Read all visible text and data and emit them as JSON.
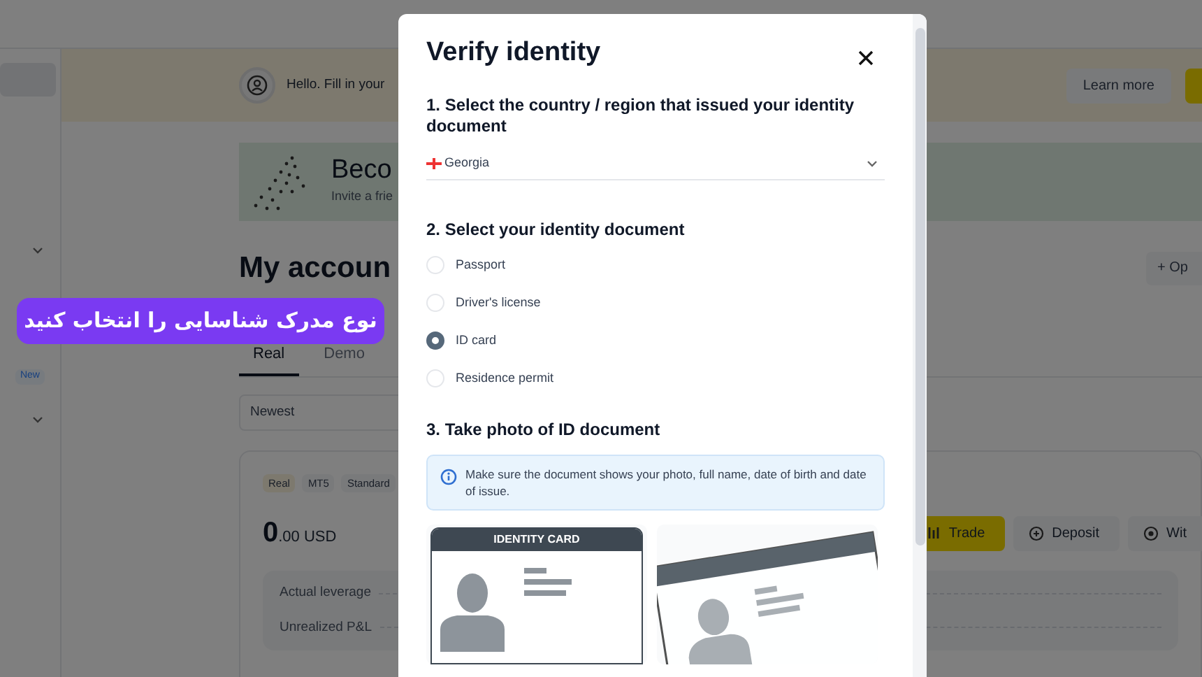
{
  "sidebar": {
    "badge": "New"
  },
  "banner": {
    "text": "Hello. Fill in your",
    "learn_more": "Learn more"
  },
  "promo": {
    "title": "Beco",
    "subtitle": "Invite a frie"
  },
  "accounts": {
    "title": "My accoun",
    "open_button": "+ Op",
    "tabs": [
      {
        "label": "Real",
        "selected": true
      },
      {
        "label": "Demo",
        "selected": false
      }
    ],
    "sort": "Newest",
    "card": {
      "badges": [
        "Real",
        "MT5",
        "Standard"
      ],
      "balance_integer": "0",
      "balance_fraction": ".00 USD",
      "actions": [
        {
          "label": "Trade",
          "kind": "primary"
        },
        {
          "label": "Deposit",
          "kind": "deposit"
        },
        {
          "label": "Wit",
          "kind": "withdraw"
        }
      ],
      "stats": [
        "Actual leverage",
        "Unrealized P&L"
      ]
    }
  },
  "annotation": "نوع مدرک شناسایی را انتخاب کنید",
  "modal": {
    "title": "Verify identity",
    "step1": {
      "heading": "1. Select the country / region that issued your identity document",
      "value": "Georgia"
    },
    "step2": {
      "heading": "2. Select your identity document",
      "options": [
        {
          "label": "Passport",
          "selected": false
        },
        {
          "label": "Driver's license",
          "selected": false
        },
        {
          "label": "ID card",
          "selected": true
        },
        {
          "label": "Residence permit",
          "selected": false
        }
      ]
    },
    "step3": {
      "heading": "3. Take photo of ID document",
      "info": "Make sure the document shows your photo, full name, date of birth and date of issue.",
      "card_label": "IDENTITY CARD"
    }
  }
}
